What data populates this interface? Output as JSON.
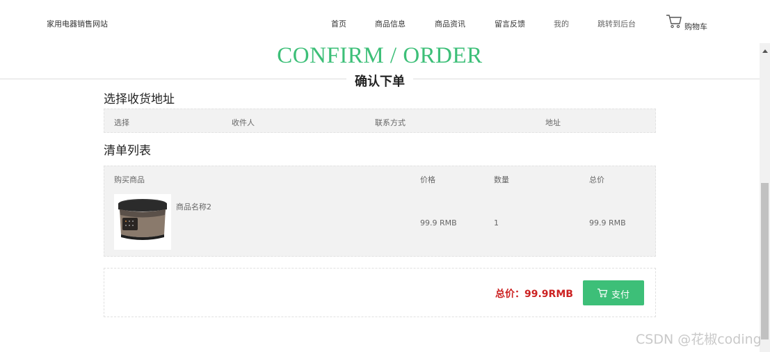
{
  "header": {
    "site_title": "家用电器销售网站",
    "nav": [
      "首页",
      "商品信息",
      "商品资讯",
      "留言反馈",
      "我的",
      "跳转到后台"
    ],
    "cart_label": "购物车"
  },
  "hero": {
    "title": "CONFIRM / ORDER",
    "subtitle": "确认下单"
  },
  "address_section": {
    "title": "选择收货地址",
    "columns": [
      "选择",
      "收件人",
      "联系方式",
      "地址"
    ]
  },
  "order_section": {
    "title": "清单列表",
    "columns": [
      "购买商品",
      "价格",
      "数量",
      "总价"
    ],
    "rows": [
      {
        "name": "商品名称2",
        "price": "99.9 RMB",
        "quantity": "1",
        "total": "99.9 RMB",
        "image": "rice-cooker"
      }
    ]
  },
  "payment": {
    "total_label": "总价：99.9RMB",
    "pay_label": "支付"
  },
  "watermark": "CSDN @花椒coding",
  "colors": {
    "accent": "#3dbf78",
    "total": "#cc2222"
  }
}
